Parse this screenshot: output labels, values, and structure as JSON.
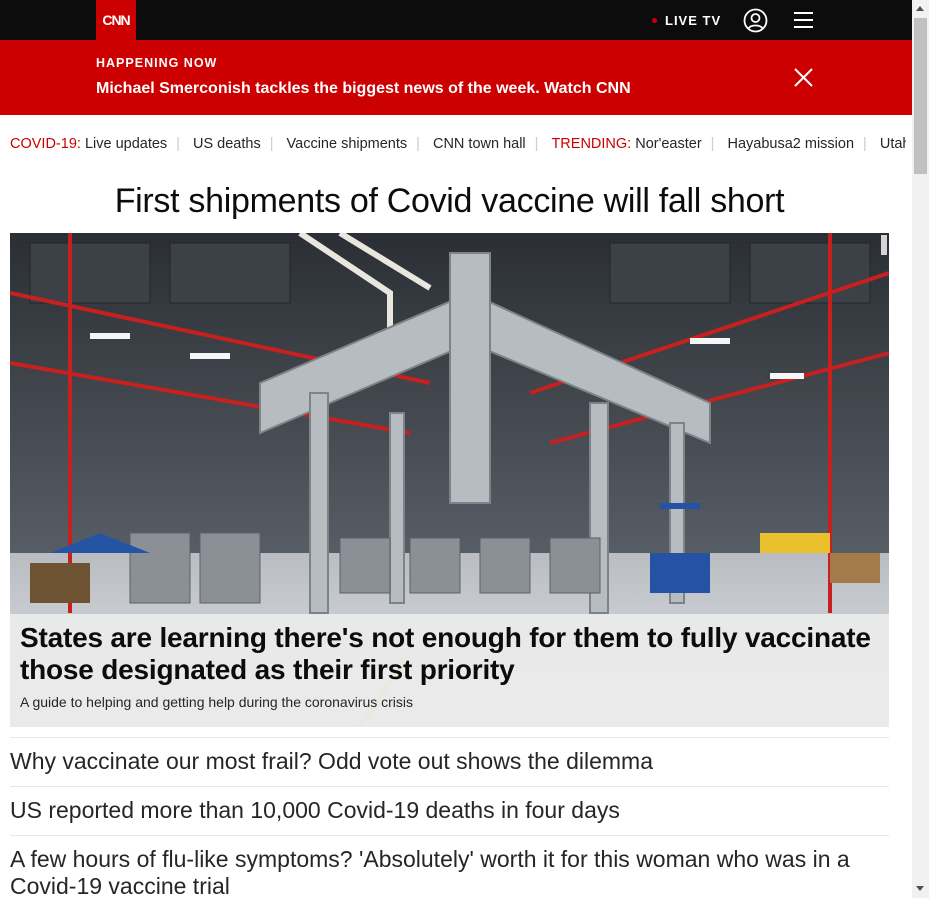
{
  "nav": {
    "logo_text": "CNN",
    "live_label": "LIVE TV",
    "user_icon": "user-icon",
    "menu_icon": "hamburger-menu-icon"
  },
  "banner": {
    "kicker": "HAPPENING NOW",
    "message": "Michael Smerconish tackles the biggest news of the week. Watch CNN",
    "close_icon": "close-icon"
  },
  "trending": {
    "covid_label": "COVID-19:",
    "covid_links": [
      "Live updates",
      "US deaths",
      "Vaccine shipments",
      "CNN town hall"
    ],
    "trending_label": "TRENDING:",
    "trending_links": [
      "Nor'easter",
      "Hayabusa2 mission",
      "Utah mo"
    ]
  },
  "main": {
    "headline": "First shipments of Covid vaccine will fall short",
    "hero_title": "States are learning there's not enough for them to fully vaccinate those designated as their first priority",
    "hero_subtitle": "A guide to helping and getting help during the coronavirus crisis"
  },
  "stories": [
    "Why vaccinate our most frail? Odd vote out shows the dilemma",
    "US reported more than 10,000 Covid-19 deaths in four days",
    "A few hours of flu-like symptoms? 'Absolutely' worth it for this woman who was in a Covid-19 vaccine trial"
  ],
  "colors": {
    "brand_red": "#cc0000",
    "nav_black": "#0c0c0c"
  }
}
